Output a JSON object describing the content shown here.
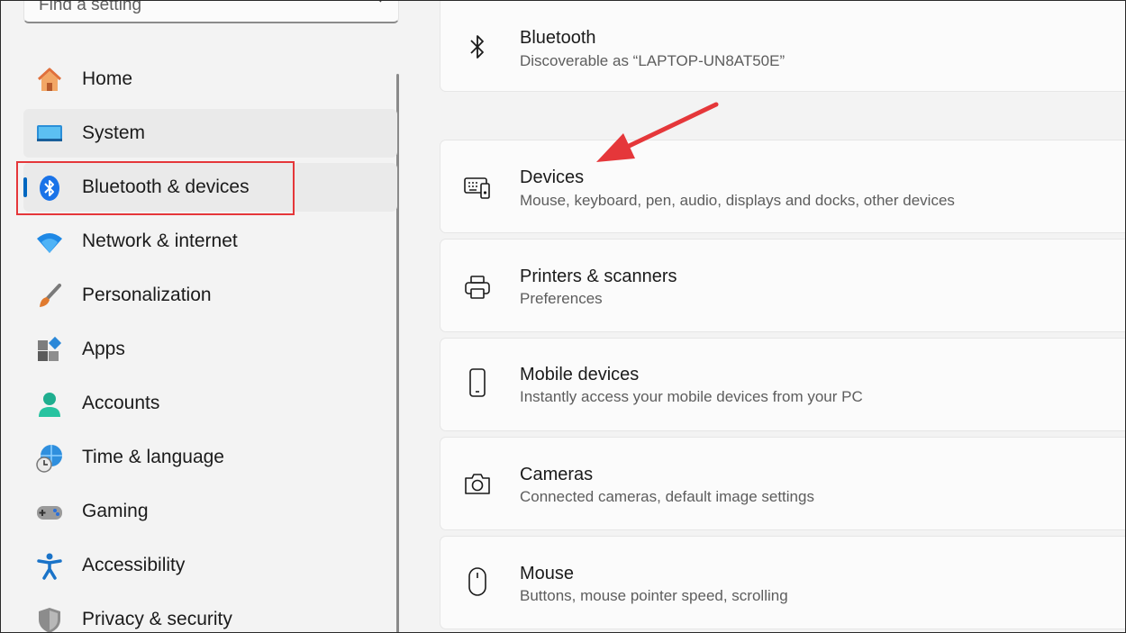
{
  "search": {
    "placeholder": "Find a setting",
    "icon": "search-icon"
  },
  "sidebar": {
    "items": [
      {
        "label": "Home",
        "icon": "home-icon"
      },
      {
        "label": "System",
        "icon": "monitor-icon"
      },
      {
        "label": "Bluetooth & devices",
        "icon": "bluetooth-icon",
        "selected": true
      },
      {
        "label": "Network & internet",
        "icon": "wifi-icon"
      },
      {
        "label": "Personalization",
        "icon": "brush-icon"
      },
      {
        "label": "Apps",
        "icon": "apps-icon"
      },
      {
        "label": "Accounts",
        "icon": "person-icon"
      },
      {
        "label": "Time & language",
        "icon": "globe-clock-icon"
      },
      {
        "label": "Gaming",
        "icon": "gamepad-icon"
      },
      {
        "label": "Accessibility",
        "icon": "accessibility-icon"
      },
      {
        "label": "Privacy & security",
        "icon": "shield-icon"
      }
    ]
  },
  "main": {
    "cards": [
      {
        "title": "Bluetooth",
        "subtitle": "Discoverable as “LAPTOP-UN8AT50E”",
        "icon": "bluetooth-icon"
      },
      {
        "title": "Devices",
        "subtitle": "Mouse, keyboard, pen, audio, displays and docks, other devices",
        "icon": "devices-icon"
      },
      {
        "title": "Printers & scanners",
        "subtitle": "Preferences",
        "icon": "printer-icon"
      },
      {
        "title": "Mobile devices",
        "subtitle": "Instantly access your mobile devices from your PC",
        "icon": "phone-icon"
      },
      {
        "title": "Cameras",
        "subtitle": "Connected cameras, default image settings",
        "icon": "camera-icon"
      },
      {
        "title": "Mouse",
        "subtitle": "Buttons, mouse pointer speed, scrolling",
        "icon": "mouse-icon"
      }
    ]
  },
  "colors": {
    "accent": "#0067c0",
    "annotation": "#e5373a"
  }
}
